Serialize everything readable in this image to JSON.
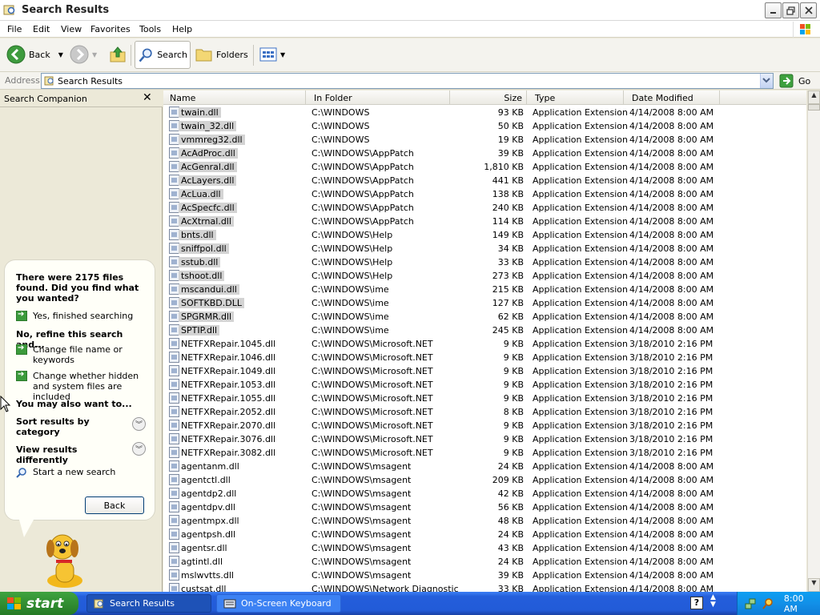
{
  "window": {
    "title": "Search Results"
  },
  "menu": [
    "File",
    "Edit",
    "View",
    "Favorites",
    "Tools",
    "Help"
  ],
  "toolbar": {
    "back": "Back",
    "search": "Search",
    "folders": "Folders"
  },
  "address": {
    "label": "Address",
    "value": "Search Results",
    "go": "Go"
  },
  "companion": {
    "title": "Search Companion",
    "close": "✕",
    "message": "There were 2175 files found. Did you find what you wanted?",
    "yes_finished": "Yes, finished searching",
    "refine_heading": "No, refine this search and...",
    "change_name": "Change file name or keywords",
    "change_hidden": "Change whether hidden and system files are included",
    "also_heading": "You may also want to...",
    "sort_results": "Sort results by category",
    "view_results": "View results differently",
    "new_search": "Start a new search",
    "back_button": "Back"
  },
  "columns": {
    "name": "Name",
    "folder": "In Folder",
    "size": "Size",
    "type": "Type",
    "date": "Date Modified"
  },
  "files": [
    {
      "name": "twain.dll",
      "folder": "C:\\WINDOWS",
      "size": "93 KB",
      "type": "Application Extension",
      "date": "4/14/2008 8:00 AM",
      "selected": true
    },
    {
      "name": "twain_32.dll",
      "folder": "C:\\WINDOWS",
      "size": "50 KB",
      "type": "Application Extension",
      "date": "4/14/2008 8:00 AM",
      "selected": true
    },
    {
      "name": "vmmreg32.dll",
      "folder": "C:\\WINDOWS",
      "size": "19 KB",
      "type": "Application Extension",
      "date": "4/14/2008 8:00 AM",
      "selected": true
    },
    {
      "name": "AcAdProc.dll",
      "folder": "C:\\WINDOWS\\AppPatch",
      "size": "39 KB",
      "type": "Application Extension",
      "date": "4/14/2008 8:00 AM",
      "selected": true
    },
    {
      "name": "AcGenral.dll",
      "folder": "C:\\WINDOWS\\AppPatch",
      "size": "1,810 KB",
      "type": "Application Extension",
      "date": "4/14/2008 8:00 AM",
      "selected": true
    },
    {
      "name": "AcLayers.dll",
      "folder": "C:\\WINDOWS\\AppPatch",
      "size": "441 KB",
      "type": "Application Extension",
      "date": "4/14/2008 8:00 AM",
      "selected": true
    },
    {
      "name": "AcLua.dll",
      "folder": "C:\\WINDOWS\\AppPatch",
      "size": "138 KB",
      "type": "Application Extension",
      "date": "4/14/2008 8:00 AM",
      "selected": true
    },
    {
      "name": "AcSpecfc.dll",
      "folder": "C:\\WINDOWS\\AppPatch",
      "size": "240 KB",
      "type": "Application Extension",
      "date": "4/14/2008 8:00 AM",
      "selected": true
    },
    {
      "name": "AcXtrnal.dll",
      "folder": "C:\\WINDOWS\\AppPatch",
      "size": "114 KB",
      "type": "Application Extension",
      "date": "4/14/2008 8:00 AM",
      "selected": true
    },
    {
      "name": "bnts.dll",
      "folder": "C:\\WINDOWS\\Help",
      "size": "149 KB",
      "type": "Application Extension",
      "date": "4/14/2008 8:00 AM",
      "selected": true
    },
    {
      "name": "sniffpol.dll",
      "folder": "C:\\WINDOWS\\Help",
      "size": "34 KB",
      "type": "Application Extension",
      "date": "4/14/2008 8:00 AM",
      "selected": true
    },
    {
      "name": "sstub.dll",
      "folder": "C:\\WINDOWS\\Help",
      "size": "33 KB",
      "type": "Application Extension",
      "date": "4/14/2008 8:00 AM",
      "selected": true
    },
    {
      "name": "tshoot.dll",
      "folder": "C:\\WINDOWS\\Help",
      "size": "273 KB",
      "type": "Application Extension",
      "date": "4/14/2008 8:00 AM",
      "selected": true
    },
    {
      "name": "mscandui.dll",
      "folder": "C:\\WINDOWS\\ime",
      "size": "215 KB",
      "type": "Application Extension",
      "date": "4/14/2008 8:00 AM",
      "selected": true
    },
    {
      "name": "SOFTKBD.DLL",
      "folder": "C:\\WINDOWS\\ime",
      "size": "127 KB",
      "type": "Application Extension",
      "date": "4/14/2008 8:00 AM",
      "selected": true
    },
    {
      "name": "SPGRMR.dll",
      "folder": "C:\\WINDOWS\\ime",
      "size": "62 KB",
      "type": "Application Extension",
      "date": "4/14/2008 8:00 AM",
      "selected": true
    },
    {
      "name": "SPTIP.dll",
      "folder": "C:\\WINDOWS\\ime",
      "size": "245 KB",
      "type": "Application Extension",
      "date": "4/14/2008 8:00 AM",
      "selected": true
    },
    {
      "name": "NETFXRepair.1045.dll",
      "folder": "C:\\WINDOWS\\Microsoft.NET",
      "size": "9 KB",
      "type": "Application Extension",
      "date": "3/18/2010 2:16 PM",
      "selected": false
    },
    {
      "name": "NETFXRepair.1046.dll",
      "folder": "C:\\WINDOWS\\Microsoft.NET",
      "size": "9 KB",
      "type": "Application Extension",
      "date": "3/18/2010 2:16 PM",
      "selected": false
    },
    {
      "name": "NETFXRepair.1049.dll",
      "folder": "C:\\WINDOWS\\Microsoft.NET",
      "size": "9 KB",
      "type": "Application Extension",
      "date": "3/18/2010 2:16 PM",
      "selected": false
    },
    {
      "name": "NETFXRepair.1053.dll",
      "folder": "C:\\WINDOWS\\Microsoft.NET",
      "size": "9 KB",
      "type": "Application Extension",
      "date": "3/18/2010 2:16 PM",
      "selected": false
    },
    {
      "name": "NETFXRepair.1055.dll",
      "folder": "C:\\WINDOWS\\Microsoft.NET",
      "size": "9 KB",
      "type": "Application Extension",
      "date": "3/18/2010 2:16 PM",
      "selected": false
    },
    {
      "name": "NETFXRepair.2052.dll",
      "folder": "C:\\WINDOWS\\Microsoft.NET",
      "size": "8 KB",
      "type": "Application Extension",
      "date": "3/18/2010 2:16 PM",
      "selected": false
    },
    {
      "name": "NETFXRepair.2070.dll",
      "folder": "C:\\WINDOWS\\Microsoft.NET",
      "size": "9 KB",
      "type": "Application Extension",
      "date": "3/18/2010 2:16 PM",
      "selected": false
    },
    {
      "name": "NETFXRepair.3076.dll",
      "folder": "C:\\WINDOWS\\Microsoft.NET",
      "size": "9 KB",
      "type": "Application Extension",
      "date": "3/18/2010 2:16 PM",
      "selected": false
    },
    {
      "name": "NETFXRepair.3082.dll",
      "folder": "C:\\WINDOWS\\Microsoft.NET",
      "size": "9 KB",
      "type": "Application Extension",
      "date": "3/18/2010 2:16 PM",
      "selected": false
    },
    {
      "name": "agentanm.dll",
      "folder": "C:\\WINDOWS\\msagent",
      "size": "24 KB",
      "type": "Application Extension",
      "date": "4/14/2008 8:00 AM",
      "selected": false
    },
    {
      "name": "agentctl.dll",
      "folder": "C:\\WINDOWS\\msagent",
      "size": "209 KB",
      "type": "Application Extension",
      "date": "4/14/2008 8:00 AM",
      "selected": false
    },
    {
      "name": "agentdp2.dll",
      "folder": "C:\\WINDOWS\\msagent",
      "size": "42 KB",
      "type": "Application Extension",
      "date": "4/14/2008 8:00 AM",
      "selected": false
    },
    {
      "name": "agentdpv.dll",
      "folder": "C:\\WINDOWS\\msagent",
      "size": "56 KB",
      "type": "Application Extension",
      "date": "4/14/2008 8:00 AM",
      "selected": false
    },
    {
      "name": "agentmpx.dll",
      "folder": "C:\\WINDOWS\\msagent",
      "size": "48 KB",
      "type": "Application Extension",
      "date": "4/14/2008 8:00 AM",
      "selected": false
    },
    {
      "name": "agentpsh.dll",
      "folder": "C:\\WINDOWS\\msagent",
      "size": "24 KB",
      "type": "Application Extension",
      "date": "4/14/2008 8:00 AM",
      "selected": false
    },
    {
      "name": "agentsr.dll",
      "folder": "C:\\WINDOWS\\msagent",
      "size": "43 KB",
      "type": "Application Extension",
      "date": "4/14/2008 8:00 AM",
      "selected": false
    },
    {
      "name": "agtintl.dll",
      "folder": "C:\\WINDOWS\\msagent",
      "size": "24 KB",
      "type": "Application Extension",
      "date": "4/14/2008 8:00 AM",
      "selected": false
    },
    {
      "name": "mslwvtts.dll",
      "folder": "C:\\WINDOWS\\msagent",
      "size": "39 KB",
      "type": "Application Extension",
      "date": "4/14/2008 8:00 AM",
      "selected": false
    },
    {
      "name": "custsat.dll",
      "folder": "C:\\WINDOWS\\Network Diagnostic",
      "size": "33 KB",
      "type": "Application Extension",
      "date": "4/14/2008 8:00 AM",
      "selected": false
    }
  ],
  "taskbar": {
    "start": "start",
    "tasks": [
      "Search Results",
      "On-Screen Keyboard"
    ],
    "clock": "8:00 AM",
    "help": "?"
  },
  "colors": {
    "taskbar": "#245edb",
    "start": "#3c9b3c",
    "selection": "#d3d3d3"
  }
}
